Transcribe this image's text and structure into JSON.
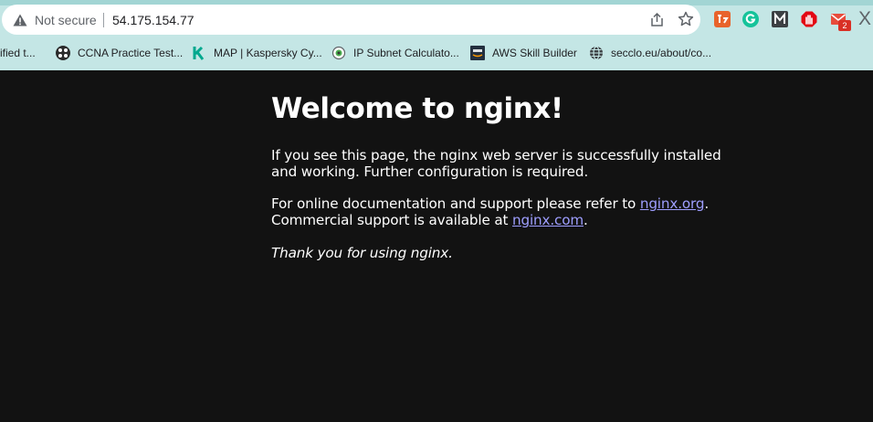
{
  "browser": {
    "security_label": "Not secure",
    "url": "54.175.154.77",
    "extensions": [
      {
        "name": "todoist-extension-icon"
      },
      {
        "name": "grammarly-extension-icon"
      },
      {
        "name": "m-extension-icon"
      },
      {
        "name": "adblock-extension-icon"
      },
      {
        "name": "gmail-checker-extension-icon",
        "badge": "2"
      },
      {
        "name": "x-extension-icon",
        "label": "X"
      }
    ],
    "bookmarks": [
      {
        "label": "rified t...",
        "icon": "verified-icon"
      },
      {
        "label": "CCNA Practice Test...",
        "icon": "ccna-icon"
      },
      {
        "label": "MAP | Kaspersky Cy...",
        "icon": "kaspersky-icon"
      },
      {
        "label": "IP Subnet Calculato...",
        "icon": "subnet-calculator-icon"
      },
      {
        "label": "AWS Skill Builder",
        "icon": "aws-icon"
      },
      {
        "label": "secclo.eu/about/co...",
        "icon": "globe-icon"
      }
    ],
    "colors": {
      "chrome_bg": "#c4e6e5",
      "page_bg": "#121212",
      "link": "#9e9eff"
    }
  },
  "page": {
    "title": "Welcome to nginx!",
    "para1": "If you see this page, the nginx web server is successfully installed and working. Further configuration is required.",
    "para2_prefix": "For online documentation and support please refer to ",
    "link1": "nginx.org",
    "para2_mid": ".",
    "para2_line2_prefix": "Commercial support is available at ",
    "link2": "nginx.com",
    "para2_end": ".",
    "para3": "Thank you for using nginx."
  }
}
